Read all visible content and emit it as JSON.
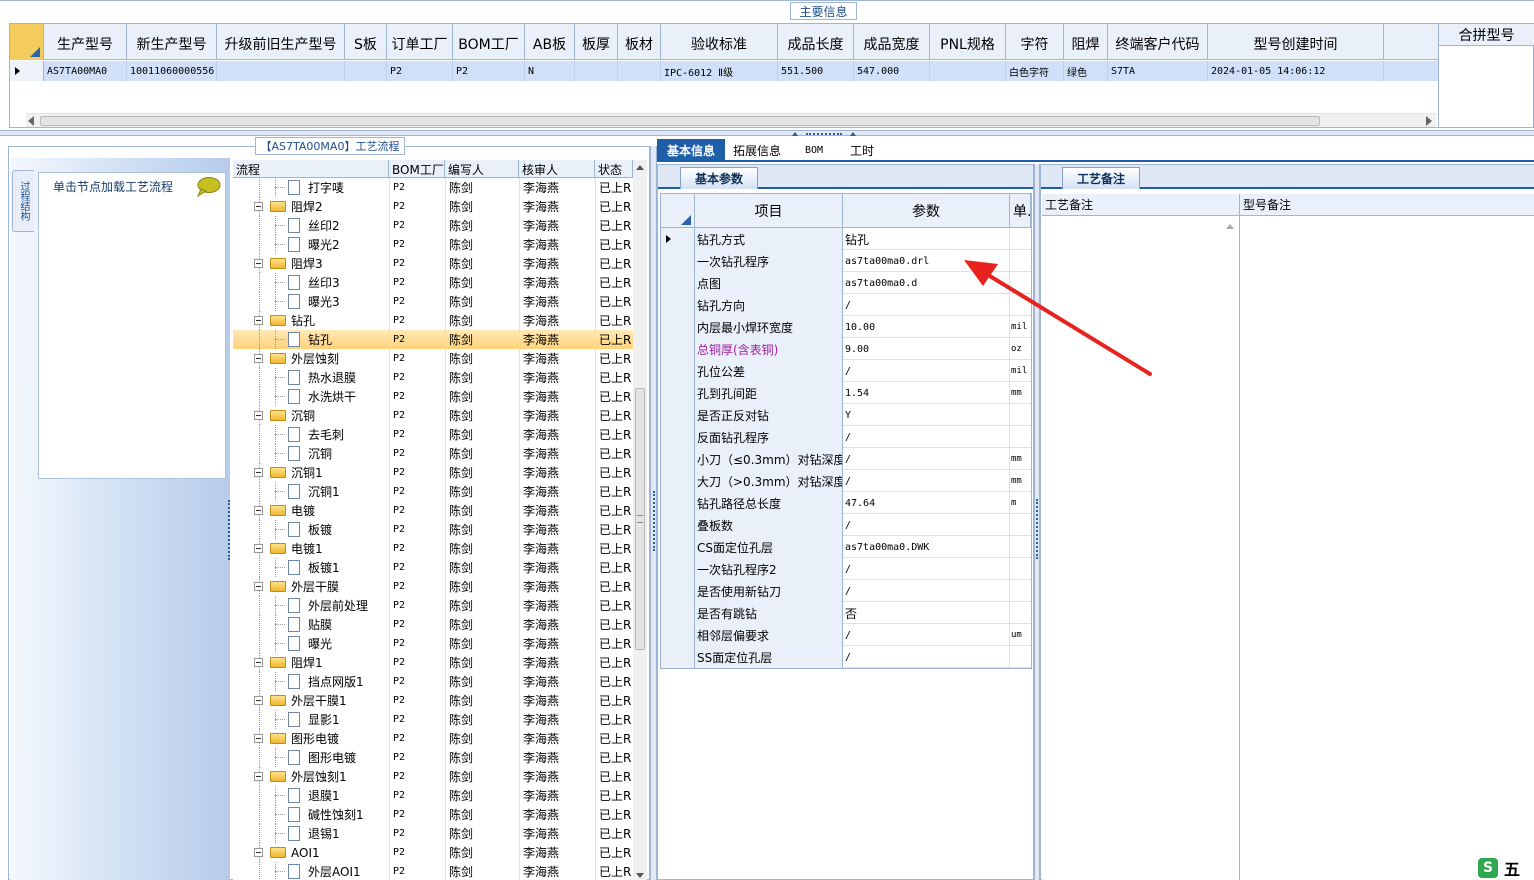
{
  "top": {
    "section_title": "主要信息",
    "columns": [
      "生产型号",
      "新生产型号",
      "升级前旧生产型号",
      "S板",
      "订单工厂",
      "BOM工厂",
      "AB板",
      "板厚",
      "板材",
      "验收标准",
      "成品长度",
      "成品宽度",
      "PNL规格",
      "字符",
      "阻焊",
      "终端客户代码",
      "型号创建时间"
    ],
    "row": [
      "AS7TA00MA0",
      "10011060000556",
      "",
      "",
      "P2",
      "P2",
      "N",
      "",
      "",
      "IPC-6012 Ⅱ级",
      "551.500",
      "547.000",
      "",
      "白色字符",
      "绿色",
      "S7TA",
      "2024-01-05 14:06:12"
    ],
    "side_header": "合拼型号"
  },
  "flow": {
    "title": "【AS7TA00MA0】工艺流程",
    "vertical_tab": "过程结构",
    "hint": "单击节点加载工艺流程",
    "columns": [
      "流程",
      "BOM工厂",
      "编写人",
      "核审人",
      "状态"
    ],
    "rows": [
      {
        "name": "打字唛",
        "level": 2,
        "bom": "P2",
        "writer": "陈剑",
        "reviewer": "李海燕",
        "status": "已上R"
      },
      {
        "name": "阻焊2",
        "level": 1,
        "bom": "P2",
        "writer": "陈剑",
        "reviewer": "李海燕",
        "status": "已上R"
      },
      {
        "name": "丝印2",
        "level": 2,
        "bom": "P2",
        "writer": "陈剑",
        "reviewer": "李海燕",
        "status": "已上R"
      },
      {
        "name": "曝光2",
        "level": 2,
        "bom": "P2",
        "writer": "陈剑",
        "reviewer": "李海燕",
        "status": "已上R"
      },
      {
        "name": "阻焊3",
        "level": 1,
        "bom": "P2",
        "writer": "陈剑",
        "reviewer": "李海燕",
        "status": "已上R"
      },
      {
        "name": "丝印3",
        "level": 2,
        "bom": "P2",
        "writer": "陈剑",
        "reviewer": "李海燕",
        "status": "已上R"
      },
      {
        "name": "曝光3",
        "level": 2,
        "bom": "P2",
        "writer": "陈剑",
        "reviewer": "李海燕",
        "status": "已上R"
      },
      {
        "name": "钻孔",
        "level": 1,
        "bom": "P2",
        "writer": "陈剑",
        "reviewer": "李海燕",
        "status": "已上R"
      },
      {
        "name": "钻孔",
        "level": 2,
        "bom": "P2",
        "writer": "陈剑",
        "reviewer": "李海燕",
        "status": "已上R"
      },
      {
        "name": "外层蚀刻",
        "level": 1,
        "bom": "P2",
        "writer": "陈剑",
        "reviewer": "李海燕",
        "status": "已上R"
      },
      {
        "name": "热水退膜",
        "level": 2,
        "bom": "P2",
        "writer": "陈剑",
        "reviewer": "李海燕",
        "status": "已上R"
      },
      {
        "name": "水洗烘干",
        "level": 2,
        "bom": "P2",
        "writer": "陈剑",
        "reviewer": "李海燕",
        "status": "已上R"
      },
      {
        "name": "沉铜",
        "level": 1,
        "bom": "P2",
        "writer": "陈剑",
        "reviewer": "李海燕",
        "status": "已上R"
      },
      {
        "name": "去毛刺",
        "level": 2,
        "bom": "P2",
        "writer": "陈剑",
        "reviewer": "李海燕",
        "status": "已上R"
      },
      {
        "name": "沉铜",
        "level": 2,
        "bom": "P2",
        "writer": "陈剑",
        "reviewer": "李海燕",
        "status": "已上R"
      },
      {
        "name": "沉铜1",
        "level": 1,
        "bom": "P2",
        "writer": "陈剑",
        "reviewer": "李海燕",
        "status": "已上R"
      },
      {
        "name": "沉铜1",
        "level": 2,
        "bom": "P2",
        "writer": "陈剑",
        "reviewer": "李海燕",
        "status": "已上R"
      },
      {
        "name": "电镀",
        "level": 1,
        "bom": "P2",
        "writer": "陈剑",
        "reviewer": "李海燕",
        "status": "已上R"
      },
      {
        "name": "板镀",
        "level": 2,
        "bom": "P2",
        "writer": "陈剑",
        "reviewer": "李海燕",
        "status": "已上R"
      },
      {
        "name": "电镀1",
        "level": 1,
        "bom": "P2",
        "writer": "陈剑",
        "reviewer": "李海燕",
        "status": "已上R"
      },
      {
        "name": "板镀1",
        "level": 2,
        "bom": "P2",
        "writer": "陈剑",
        "reviewer": "李海燕",
        "status": "已上R"
      },
      {
        "name": "外层干膜",
        "level": 1,
        "bom": "P2",
        "writer": "陈剑",
        "reviewer": "李海燕",
        "status": "已上R"
      },
      {
        "name": "外层前处理",
        "level": 2,
        "bom": "P2",
        "writer": "陈剑",
        "reviewer": "李海燕",
        "status": "已上R"
      },
      {
        "name": "贴膜",
        "level": 2,
        "bom": "P2",
        "writer": "陈剑",
        "reviewer": "李海燕",
        "status": "已上R"
      },
      {
        "name": "曝光",
        "level": 2,
        "bom": "P2",
        "writer": "陈剑",
        "reviewer": "李海燕",
        "status": "已上R"
      },
      {
        "name": "阻焊1",
        "level": 1,
        "bom": "P2",
        "writer": "陈剑",
        "reviewer": "李海燕",
        "status": "已上R"
      },
      {
        "name": "挡点网版1",
        "level": 2,
        "bom": "P2",
        "writer": "陈剑",
        "reviewer": "李海燕",
        "status": "已上R"
      },
      {
        "name": "外层干膜1",
        "level": 1,
        "bom": "P2",
        "writer": "陈剑",
        "reviewer": "李海燕",
        "status": "已上R"
      },
      {
        "name": "显影1",
        "level": 2,
        "bom": "P2",
        "writer": "陈剑",
        "reviewer": "李海燕",
        "status": "已上R"
      },
      {
        "name": "图形电镀",
        "level": 1,
        "bom": "P2",
        "writer": "陈剑",
        "reviewer": "李海燕",
        "status": "已上R"
      },
      {
        "name": "图形电镀",
        "level": 2,
        "bom": "P2",
        "writer": "陈剑",
        "reviewer": "李海燕",
        "status": "已上R"
      },
      {
        "name": "外层蚀刻1",
        "level": 1,
        "bom": "P2",
        "writer": "陈剑",
        "reviewer": "李海燕",
        "status": "已上R"
      },
      {
        "name": "退膜1",
        "level": 2,
        "bom": "P2",
        "writer": "陈剑",
        "reviewer": "李海燕",
        "status": "已上R"
      },
      {
        "name": "碱性蚀刻1",
        "level": 2,
        "bom": "P2",
        "writer": "陈剑",
        "reviewer": "李海燕",
        "status": "已上R"
      },
      {
        "name": "退锡1",
        "level": 2,
        "bom": "P2",
        "writer": "陈剑",
        "reviewer": "李海燕",
        "status": "已上R"
      },
      {
        "name": "AOI1",
        "level": 1,
        "bom": "P2",
        "writer": "陈剑",
        "reviewer": "李海燕",
        "status": "已上R"
      },
      {
        "name": "外层AOI1",
        "level": 2,
        "bom": "P2",
        "writer": "陈剑",
        "reviewer": "李海燕",
        "status": "已上R"
      }
    ]
  },
  "tabs": [
    "基本信息",
    "拓展信息",
    "BOM",
    "工时"
  ],
  "params": {
    "subtab": "基本参数",
    "columns": [
      "项目",
      "参数",
      "单."
    ],
    "rows": [
      {
        "item": "钻孔方式",
        "value": "钻孔",
        "unit": ""
      },
      {
        "item": "一次钻孔程序",
        "value": "as7ta00ma0.drl",
        "unit": ""
      },
      {
        "item": "点图",
        "value": "as7ta00ma0.d",
        "unit": ""
      },
      {
        "item": "钻孔方向",
        "value": "/",
        "unit": ""
      },
      {
        "item": "内层最小焊环宽度",
        "value": "10.00",
        "unit": "mil"
      },
      {
        "item": "总铜厚(含表铜)",
        "value": "9.00",
        "unit": "oz"
      },
      {
        "item": "孔位公差",
        "value": "/",
        "unit": "mil"
      },
      {
        "item": "孔到孔间距",
        "value": "1.54",
        "unit": "mm"
      },
      {
        "item": "是否正反对钻",
        "value": "Y",
        "unit": ""
      },
      {
        "item": "反面钻孔程序",
        "value": "/",
        "unit": ""
      },
      {
        "item": "小刀（≤0.3mm）对钻深度",
        "value": "/",
        "unit": "mm"
      },
      {
        "item": "大刀（>0.3mm）对钻深度",
        "value": "/",
        "unit": "mm"
      },
      {
        "item": "钻孔路径总长度",
        "value": "47.64",
        "unit": "m"
      },
      {
        "item": "叠板数",
        "value": "/",
        "unit": ""
      },
      {
        "item": "CS面定位孔层",
        "value": "as7ta00ma0.DWK",
        "unit": ""
      },
      {
        "item": "一次钻孔程序2",
        "value": "/",
        "unit": ""
      },
      {
        "item": "是否使用新钻刀",
        "value": "/",
        "unit": ""
      },
      {
        "item": "是否有跳钻",
        "value": "否",
        "unit": ""
      },
      {
        "item": "相邻层偏要求",
        "value": "/",
        "unit": "um"
      },
      {
        "item": "SS面定位孔层",
        "value": "/",
        "unit": ""
      }
    ]
  },
  "notes": {
    "tab": "工艺备注",
    "columns": [
      "工艺备注",
      "型号备注"
    ]
  },
  "tray_char": "五",
  "colors": {
    "selected_row": "#cfe0f8",
    "tree_highlight": "#ffd98a",
    "header_bg": "#e9f0fa",
    "magenta_label": "#a020a0",
    "arrow": "#e8231f"
  }
}
